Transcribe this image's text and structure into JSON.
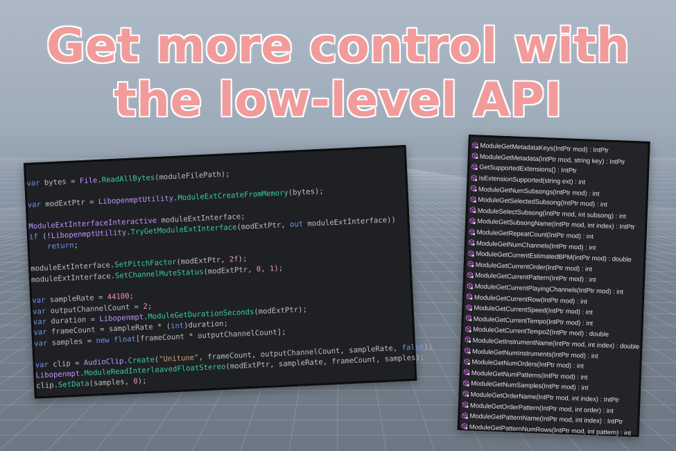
{
  "headline": {
    "line1": "Get more control with",
    "line2": "the low-level API"
  },
  "colors": {
    "headline": "#f29b9b",
    "code_bg": "#1f2023",
    "keyword": "#6c95eb",
    "type": "#c191ff",
    "method": "#39cc9b",
    "number": "#ed94c0",
    "string": "#c9a26d",
    "method_icon": "#c15fd6"
  },
  "code_lines": [
    [
      {
        "t": "var",
        "c": "kw"
      },
      {
        "t": " bytes = "
      },
      {
        "t": "File",
        "c": "ty"
      },
      {
        "t": "."
      },
      {
        "t": "ReadAllBytes",
        "c": "fn"
      },
      {
        "t": "(moduleFilePath);"
      }
    ],
    [],
    [
      {
        "t": "var",
        "c": "kw"
      },
      {
        "t": " modExtPtr = "
      },
      {
        "t": "LibopenmptUtility",
        "c": "ty"
      },
      {
        "t": "."
      },
      {
        "t": "ModuleExtCreateFromMemory",
        "c": "fn"
      },
      {
        "t": "(bytes);"
      }
    ],
    [],
    [
      {
        "t": "ModuleExtInterfaceInteractive",
        "c": "ty"
      },
      {
        "t": " moduleExtInterface;"
      }
    ],
    [
      {
        "t": "if",
        "c": "kw"
      },
      {
        "t": " (!"
      },
      {
        "t": "LibopenmptUtility",
        "c": "ty"
      },
      {
        "t": "."
      },
      {
        "t": "TryGetModuleExtInterface",
        "c": "fn"
      },
      {
        "t": "(modExtPtr, "
      },
      {
        "t": "out",
        "c": "kw"
      },
      {
        "t": " moduleExtInterface))"
      }
    ],
    [
      {
        "t": "    "
      },
      {
        "t": "return",
        "c": "kw"
      },
      {
        "t": ";"
      }
    ],
    [],
    [
      {
        "t": "moduleExtInterface."
      },
      {
        "t": "SetPitchFactor",
        "c": "fn"
      },
      {
        "t": "(modExtPtr, "
      },
      {
        "t": "2f",
        "c": "nm"
      },
      {
        "t": ");"
      }
    ],
    [
      {
        "t": "moduleExtInterface."
      },
      {
        "t": "SetChannelMuteStatus",
        "c": "fn"
      },
      {
        "t": "(modExtPtr, "
      },
      {
        "t": "0",
        "c": "nm"
      },
      {
        "t": ", "
      },
      {
        "t": "1",
        "c": "nm"
      },
      {
        "t": ");"
      }
    ],
    [],
    [
      {
        "t": "var",
        "c": "kw"
      },
      {
        "t": " sampleRate = "
      },
      {
        "t": "44100",
        "c": "nm"
      },
      {
        "t": ";"
      }
    ],
    [
      {
        "t": "var",
        "c": "kw"
      },
      {
        "t": " outputChannelCount = "
      },
      {
        "t": "2",
        "c": "nm"
      },
      {
        "t": ";"
      }
    ],
    [
      {
        "t": "var",
        "c": "kw"
      },
      {
        "t": " duration = "
      },
      {
        "t": "Libopenmpt",
        "c": "ty"
      },
      {
        "t": "."
      },
      {
        "t": "ModuleGetDurationSeconds",
        "c": "fn"
      },
      {
        "t": "(modExtPtr);"
      }
    ],
    [
      {
        "t": "var",
        "c": "kw"
      },
      {
        "t": " frameCount = sampleRate * ("
      },
      {
        "t": "int",
        "c": "kw"
      },
      {
        "t": ")duration;"
      }
    ],
    [
      {
        "t": "var",
        "c": "kw"
      },
      {
        "t": " samples = "
      },
      {
        "t": "new",
        "c": "kw"
      },
      {
        "t": " "
      },
      {
        "t": "float",
        "c": "kw"
      },
      {
        "t": "[frameCount * outputChannelCount];"
      }
    ],
    [],
    [
      {
        "t": "var",
        "c": "kw"
      },
      {
        "t": " clip = "
      },
      {
        "t": "AudioClip",
        "c": "ty"
      },
      {
        "t": "."
      },
      {
        "t": "Create",
        "c": "fn"
      },
      {
        "t": "("
      },
      {
        "t": "\"Unitune\"",
        "c": "st"
      },
      {
        "t": ", frameCount, outputChannelCount, sampleRate, "
      },
      {
        "t": "false",
        "c": "kw"
      },
      {
        "t": ");"
      }
    ],
    [
      {
        "t": "Libopenmpt",
        "c": "ty"
      },
      {
        "t": "."
      },
      {
        "t": "ModuleReadInterleavedFloatStereo",
        "c": "fn"
      },
      {
        "t": "(modExtPtr, sampleRate, frameCount, samples);"
      }
    ],
    [
      {
        "t": "clip."
      },
      {
        "t": "SetData",
        "c": "fn"
      },
      {
        "t": "(samples, "
      },
      {
        "t": "0",
        "c": "nm"
      },
      {
        "t": ");"
      }
    ]
  ],
  "api_methods": [
    "ModuleGetMetadataKeys(IntPtr mod) : IntPtr",
    "ModuleGetMetadata(IntPtr mod, string key) : IntPtr",
    "GetSupportedExtensions() : IntPtr",
    "IsExtensionSupported(string ext) : int",
    "ModuleGetNumSubsongs(IntPtr mod) : int",
    "ModuleGetSelectedSubsong(IntPtr mod) : int",
    "ModuleSelectSubsong(IntPtr mod, int subsong) : int",
    "ModuleGetSubsongName(IntPtr mod, int index) : IntPtr",
    "ModuleGetRepeatCount(IntPtr mod) : int",
    "ModuleGetNumChannels(IntPtr mod) : int",
    "ModuleGetCurrentEstimatedBPM(IntPtr mod) : double",
    "ModuleGetCurrentOrder(IntPtr mod) : int",
    "ModuleGetCurrentPattern(IntPtr mod) : int",
    "ModuleGetCurrentPlayingChannels(IntPtr mod) : int",
    "ModuleGetCurrentRow(IntPtr mod) : int",
    "ModuleGetCurrentSpeed(IntPtr mod) : int",
    "ModuleGetCurrentTempo(IntPtr mod) : int",
    "ModuleGetCurrentTempo2(IntPtr mod) : double",
    "ModuleGetInstrumentName(IntPtr mod, int index) : double",
    "ModuleGetNumInstruments(IntPtr mod) : int",
    "ModuleGetNumOrders(IntPtr mod) : int",
    "ModuleGetNumPatterns(IntPtr mod) : int",
    "ModuleGetNumSamples(IntPtr mod) : int",
    "ModuleGetOrderName(IntPtr mod, int index) : IntPtr",
    "ModuleGetOrderPattern(IntPtr mod, int order) : int",
    "ModuleGetPatternName(IntPtr mod, int index) : IntPtr",
    "ModuleGetPatternNumRows(IntPtr mod, int pattern) : int"
  ]
}
